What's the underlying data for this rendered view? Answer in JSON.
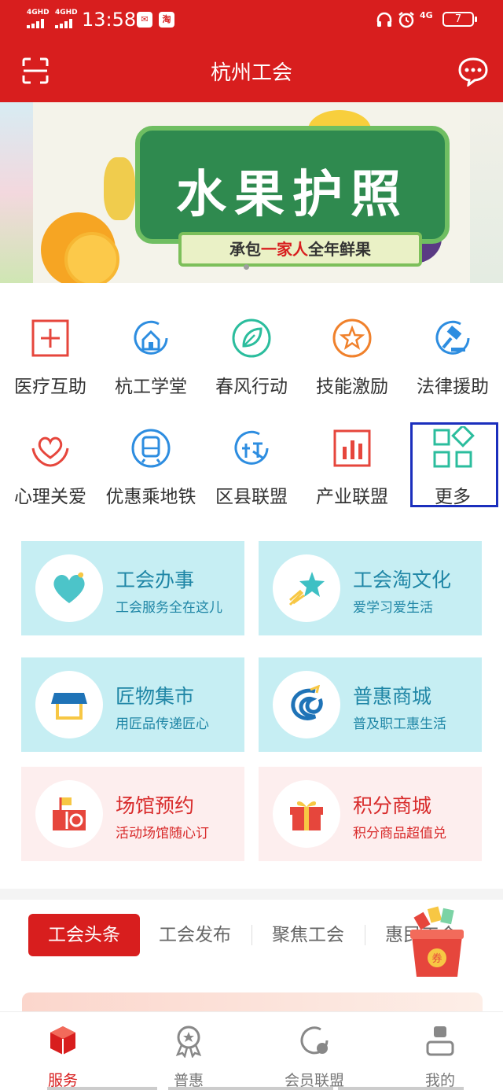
{
  "status_bar": {
    "signal1": "4GHD",
    "signal2": "4GHD",
    "time": "13:58",
    "taobao_badge": "淘",
    "network": "4G",
    "battery": "7"
  },
  "header": {
    "title": "杭州工会"
  },
  "banner": {
    "title": "水果护照",
    "subtitle_pre": "承包",
    "subtitle_hl": "一家人",
    "subtitle_post": "全年鲜果"
  },
  "grid": [
    {
      "label": "医疗互助",
      "icon": "medical-cross-icon",
      "color": "#e6463c"
    },
    {
      "label": "杭工学堂",
      "icon": "school-house-icon",
      "color": "#2d8de0"
    },
    {
      "label": "春风行动",
      "icon": "leaf-icon",
      "color": "#2bbd9d"
    },
    {
      "label": "技能激励",
      "icon": "star-icon",
      "color": "#f0812c"
    },
    {
      "label": "法律援助",
      "icon": "gavel-icon",
      "color": "#2d8de0"
    },
    {
      "label": "心理关爱",
      "icon": "heart-hands-icon",
      "color": "#e6463c"
    },
    {
      "label": "优惠乘地铁",
      "icon": "metro-train-icon",
      "color": "#2d8de0"
    },
    {
      "label": "区县联盟",
      "icon": "alliance-icon",
      "color": "#2d8de0"
    },
    {
      "label": "产业联盟",
      "icon": "bar-chart-icon",
      "color": "#e6463c"
    },
    {
      "label": "更多",
      "icon": "more-grid-icon",
      "color": "#2bbd9d"
    }
  ],
  "cards": [
    {
      "title": "工会办事",
      "sub": "工会服务全在这儿",
      "icon": "heart-icon"
    },
    {
      "title": "工会淘文化",
      "sub": "爱学习爱生活",
      "icon": "shooting-star-icon"
    },
    {
      "title": "匠物集市",
      "sub": "用匠品传递匠心",
      "icon": "market-stall-icon"
    },
    {
      "title": "普惠商城",
      "sub": "普及职工惠生活",
      "icon": "mall-logo-icon"
    },
    {
      "title": "场馆预约",
      "sub": "活动场馆随心订",
      "icon": "venue-flag-icon"
    },
    {
      "title": "积分商城",
      "sub": "积分商品超值兑",
      "icon": "gift-box-icon"
    }
  ],
  "news_tabs": [
    "工会头条",
    "工会发布",
    "聚焦工会",
    "惠民工会"
  ],
  "coupon_label": "券",
  "bottom_nav": [
    {
      "label": "服务",
      "icon": "service-cube-icon",
      "active": true
    },
    {
      "label": "普惠",
      "icon": "medal-icon",
      "active": false
    },
    {
      "label": "会员联盟",
      "icon": "member-alliance-icon",
      "active": false
    },
    {
      "label": "我的",
      "icon": "profile-icon",
      "active": false
    }
  ],
  "colors": {
    "brand_red": "#d81e1e",
    "card_blue": "#c6eef3",
    "card_pink": "#fdeeee",
    "card_text_blue": "#1f86a6",
    "highlight_border": "#1b2fbd"
  }
}
